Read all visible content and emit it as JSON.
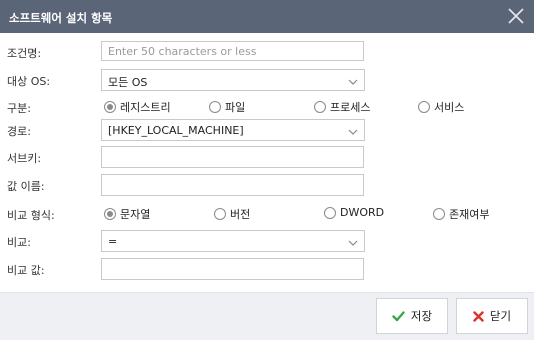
{
  "dialog": {
    "title": "소프트웨어 설치 항목"
  },
  "fields": {
    "condition_name": {
      "label": "조건명:",
      "placeholder": "Enter 50 characters or less",
      "value": ""
    },
    "target_os": {
      "label": "대상 OS:",
      "value": "모든 OS"
    },
    "category": {
      "label": "구분:",
      "options": [
        "레지스트리",
        "파일",
        "프로세스",
        "서비스"
      ],
      "selected": "레지스트리"
    },
    "path": {
      "label": "경로:",
      "value": "[HKEY_LOCAL_MACHINE]"
    },
    "subkey": {
      "label": "서브키:",
      "value": ""
    },
    "value_name": {
      "label": "값 이름:",
      "value": ""
    },
    "compare_type": {
      "label": "비교 형식:",
      "options": [
        "문자열",
        "버전",
        "DWORD",
        "존재여부"
      ],
      "selected": "문자열"
    },
    "compare": {
      "label": "비교:",
      "value": "="
    },
    "compare_value": {
      "label": "비교 값:",
      "value": ""
    }
  },
  "footer": {
    "save_label": "저장",
    "close_label": "닫기"
  },
  "colors": {
    "titlebar": "#5b6578",
    "save_check": "#3aa64a",
    "close_x": "#d9362b"
  },
  "icons": {
    "close": "close-icon",
    "save": "check-icon",
    "cancel": "x-icon",
    "dropdown": "chevron-down-icon"
  }
}
